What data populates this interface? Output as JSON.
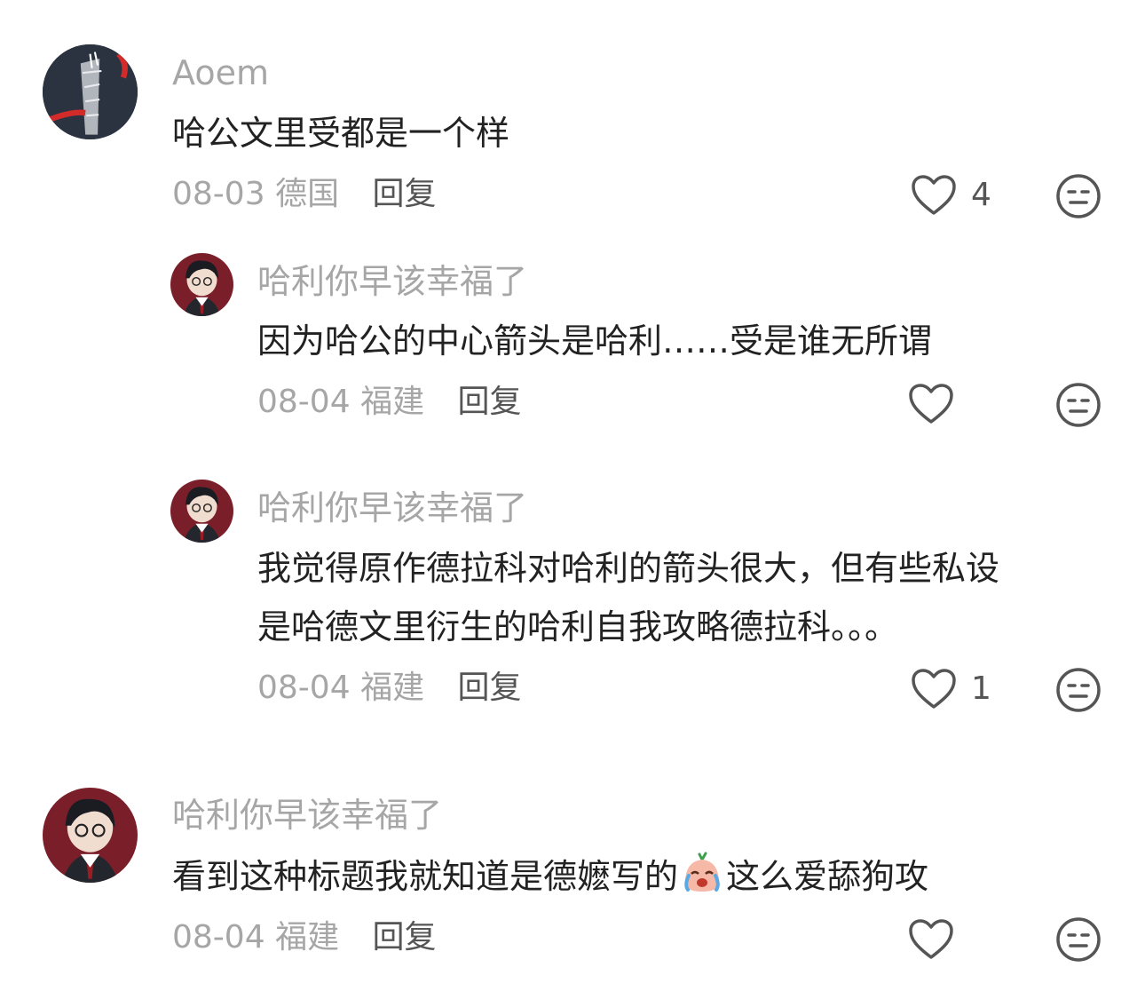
{
  "comments": [
    {
      "username": "Aoem",
      "text": "哈公文里受都是一个样",
      "date": "08-03",
      "location": "德国",
      "reply_label": "回复",
      "likes": "4"
    },
    {
      "username": "哈利你早该幸福了",
      "text": "因为哈公的中心箭头是哈利……受是谁无所谓",
      "date": "08-04",
      "location": "福建",
      "reply_label": "回复",
      "likes": ""
    },
    {
      "username": "哈利你早该幸福了",
      "text_line1": "我觉得原作德拉科对哈利的箭头很大，但有些私设",
      "text_line2": "是哈德文里衍生的哈利自我攻略德拉科。。。",
      "date": "08-04",
      "location": "福建",
      "reply_label": "回复",
      "likes": "1"
    },
    {
      "username": "哈利你早该幸福了",
      "text_before": "看到这种标题我就知道是德嬷写的",
      "emoji": "crying-face-emoji",
      "text_after": "这么爱舔狗攻",
      "date": "08-04",
      "location": "福建",
      "reply_label": "回复",
      "likes": ""
    }
  ],
  "icons": {
    "like": "heart-outline-icon",
    "dislike": "neutral-face-icon"
  },
  "colors": {
    "meta_gray": "#a6a6a6",
    "text_dark": "#222222",
    "icon_gray": "#555555"
  }
}
